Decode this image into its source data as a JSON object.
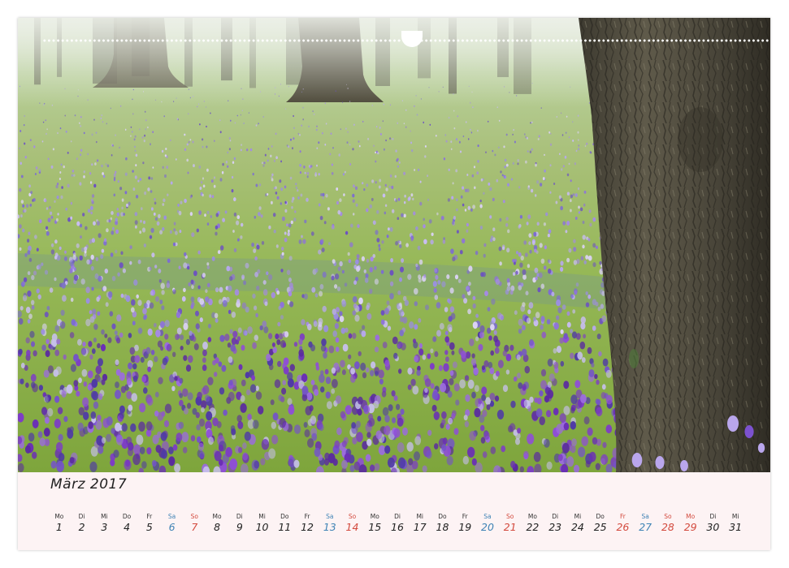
{
  "calendar": {
    "month_title": "März 2017",
    "days": [
      {
        "wd": "Mo",
        "num": "1",
        "type": "weekday"
      },
      {
        "wd": "Di",
        "num": "2",
        "type": "weekday"
      },
      {
        "wd": "Mi",
        "num": "3",
        "type": "weekday"
      },
      {
        "wd": "Do",
        "num": "4",
        "type": "weekday"
      },
      {
        "wd": "Fr",
        "num": "5",
        "type": "weekday"
      },
      {
        "wd": "Sa",
        "num": "6",
        "type": "sat"
      },
      {
        "wd": "So",
        "num": "7",
        "type": "sun"
      },
      {
        "wd": "Mo",
        "num": "8",
        "type": "weekday"
      },
      {
        "wd": "Di",
        "num": "9",
        "type": "weekday"
      },
      {
        "wd": "Mi",
        "num": "10",
        "type": "weekday"
      },
      {
        "wd": "Do",
        "num": "11",
        "type": "weekday"
      },
      {
        "wd": "Fr",
        "num": "12",
        "type": "weekday"
      },
      {
        "wd": "Sa",
        "num": "13",
        "type": "sat"
      },
      {
        "wd": "So",
        "num": "14",
        "type": "sun"
      },
      {
        "wd": "Mo",
        "num": "15",
        "type": "weekday"
      },
      {
        "wd": "Di",
        "num": "16",
        "type": "weekday"
      },
      {
        "wd": "Mi",
        "num": "17",
        "type": "weekday"
      },
      {
        "wd": "Do",
        "num": "18",
        "type": "weekday"
      },
      {
        "wd": "Fr",
        "num": "19",
        "type": "weekday"
      },
      {
        "wd": "Sa",
        "num": "20",
        "type": "sat"
      },
      {
        "wd": "So",
        "num": "21",
        "type": "sun"
      },
      {
        "wd": "Mo",
        "num": "22",
        "type": "weekday"
      },
      {
        "wd": "Di",
        "num": "23",
        "type": "weekday"
      },
      {
        "wd": "Mi",
        "num": "24",
        "type": "weekday"
      },
      {
        "wd": "Do",
        "num": "25",
        "type": "weekday"
      },
      {
        "wd": "Fr",
        "num": "26",
        "type": "hol"
      },
      {
        "wd": "Sa",
        "num": "27",
        "type": "sat"
      },
      {
        "wd": "So",
        "num": "28",
        "type": "sun"
      },
      {
        "wd": "Mo",
        "num": "29",
        "type": "hol"
      },
      {
        "wd": "Di",
        "num": "30",
        "type": "weekday"
      },
      {
        "wd": "Mi",
        "num": "31",
        "type": "weekday"
      }
    ]
  },
  "colors": {
    "saturday": "#3f83b5",
    "sunday": "#d34a3e",
    "calendar_bg": "#fdf3f4"
  }
}
